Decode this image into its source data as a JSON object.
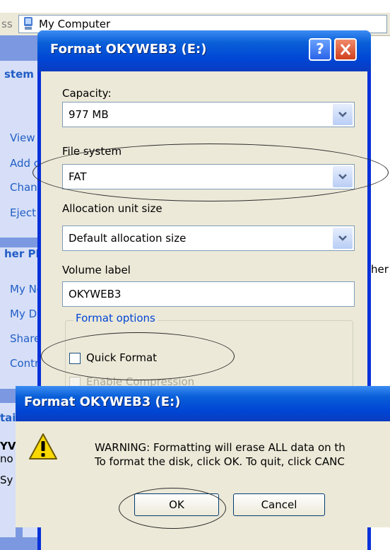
{
  "explorer": {
    "address_label_partial": "ss",
    "address_value": "My Computer",
    "task_pane": {
      "system_tasks_header_partial": "stem T",
      "system_tasks_links": [
        "View",
        "Add c",
        "Chan",
        "Eject"
      ],
      "other_places_header_partial": "her Pla",
      "other_places_links": [
        "My Ne",
        "My Do",
        "Share",
        "Contr"
      ],
      "details_header_partial": "tai",
      "details_lines": [
        "YV",
        "no",
        "Sy"
      ]
    },
    "right_edge_text": "her"
  },
  "format_dialog": {
    "title": "Format OKYWEB3 (E:)",
    "help_symbol": "?",
    "capacity_label": "Capacity:",
    "capacity_value": "977 MB",
    "file_system_label": "File system",
    "file_system_value": "FAT",
    "allocation_label": "Allocation unit size",
    "allocation_value": "Default allocation size",
    "volume_label_label": "Volume label",
    "volume_label_value": "OKYWEB3",
    "format_options_label": "Format options",
    "quick_format_label": "Quick Format",
    "quick_format_checked": false,
    "enable_compression_label": "Enable Compression",
    "enable_compression_enabled": false
  },
  "warning_dialog": {
    "title": "Format OKYWEB3 (E:)",
    "message_line1": "WARNING: Formatting will erase ALL data on th",
    "message_line2": "To format the disk, click OK. To quit, click CANC",
    "ok_label": "OK",
    "cancel_label": "Cancel"
  },
  "colors": {
    "xp_blue": "#0046d5",
    "dialog_face": "#ece9d8",
    "task_pane_blue": "#7b98e0",
    "link_blue": "#215dc6"
  },
  "icons": [
    "my-computer-icon",
    "help-icon",
    "close-icon",
    "dropdown-arrow-icon",
    "warning-icon"
  ]
}
